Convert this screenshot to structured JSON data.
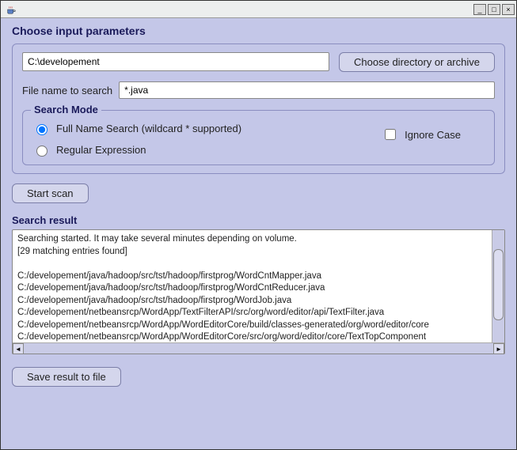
{
  "titlebar": {
    "minimize": "_",
    "maximize": "□",
    "close": "×"
  },
  "header": {
    "title": "Choose input parameters"
  },
  "directory": {
    "value": "C:\\developement",
    "choose_btn": "Choose directory or archive"
  },
  "filename": {
    "label": "File name to search",
    "value": "*.java"
  },
  "search_mode": {
    "group_label": "Search Mode",
    "full_name": "Full Name Search (wildcard * supported)",
    "regex": "Regular Expression",
    "ignore_case": "Ignore Case"
  },
  "actions": {
    "start": "Start scan",
    "save": "Save result to file"
  },
  "result": {
    "header": "Search result",
    "lines": [
      "Searching started. It may take several minutes depending on volume.",
      "[29 matching entries found]",
      "",
      "C:/developement/java/hadoop/src/tst/hadoop/firstprog/WordCntMapper.java",
      "C:/developement/java/hadoop/src/tst/hadoop/firstprog/WordCntReducer.java",
      "C:/developement/java/hadoop/src/tst/hadoop/firstprog/WordJob.java",
      "C:/developement/netbeansrcp/WordApp/TextFilterAPI/src/org/word/editor/api/TextFilter.java",
      "C:/developement/netbeansrcp/WordApp/WordEditorCore/build/classes-generated/org/word/editor/core",
      "C:/developement/netbeansrcp/WordApp/WordEditorCore/src/org/word/editor/core/TextTopComponent"
    ]
  }
}
